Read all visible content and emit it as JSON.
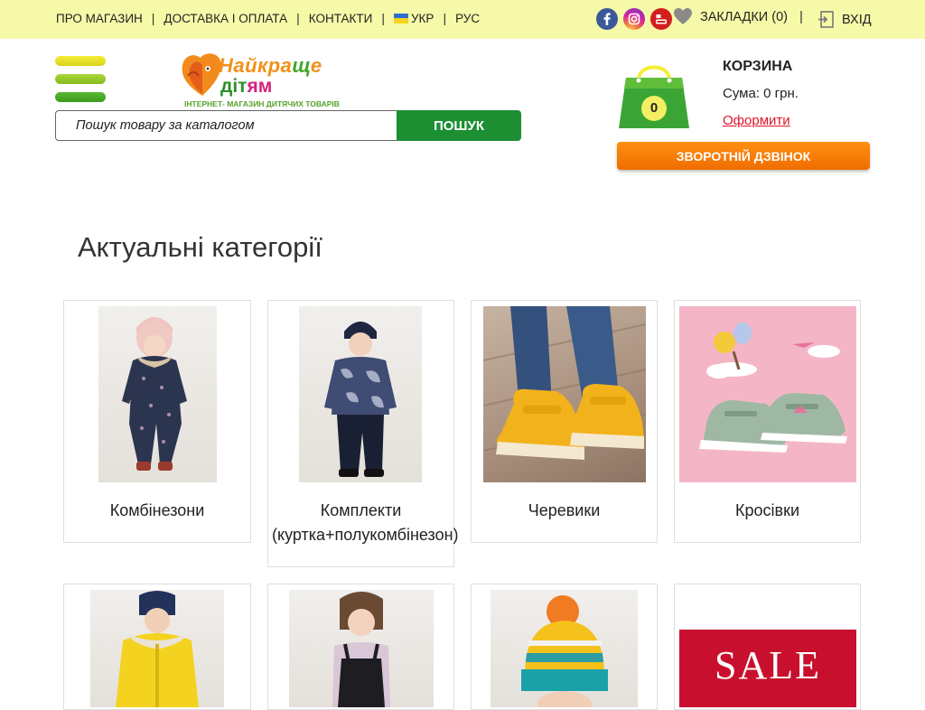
{
  "topbar": {
    "nav": [
      {
        "label": "ПРО МАГАЗИН"
      },
      {
        "label": "ДОСТАВКА І ОПЛАТА"
      },
      {
        "label": "КОНТАКТИ"
      }
    ],
    "lang_ukr": "УКР",
    "lang_rus": "РУС",
    "bookmarks": "ЗАКЛАДКИ (0)",
    "login": "ВХІД",
    "social": [
      "facebook-icon",
      "instagram-icon",
      "youtube-icon"
    ]
  },
  "logo": {
    "line1a": "Найкра",
    "line1b": "щ",
    "line1c": "е",
    "line2a": "діт",
    "line2b": "ям",
    "tagline": "ІНТЕРНЕТ- МАГАЗИН ДИТЯЧИХ ТОВАРІВ"
  },
  "search": {
    "placeholder": "Пошук товару за каталогом",
    "button": "ПОШУК"
  },
  "cart": {
    "count": "0",
    "title": "КОРЗИНА",
    "sum": "Сума: 0 грн.",
    "checkout": "Оформити"
  },
  "callback": "ЗВОРОТНІЙ ДЗВІНОК",
  "categories": {
    "title": "Актуальні категорії",
    "items": [
      {
        "label": "Комбінезони"
      },
      {
        "label": "Комплекти (куртка+полукомбінезон)"
      },
      {
        "label": "Черевики"
      },
      {
        "label": "Кросівки"
      },
      {
        "label": ""
      },
      {
        "label": ""
      },
      {
        "label": ""
      },
      {
        "label": ""
      }
    ],
    "sale_text": "SALE"
  },
  "colors": {
    "topbar": "#f6f9a8",
    "green": "#1d8f33",
    "orange": "#f06d00",
    "link_red": "#e0142a"
  }
}
